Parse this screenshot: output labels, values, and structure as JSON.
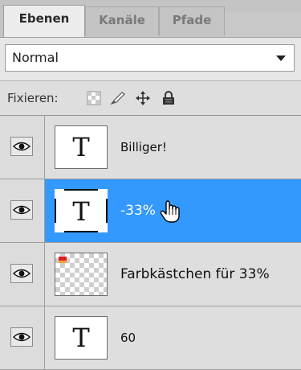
{
  "tabs": [
    {
      "label": "Ebenen",
      "active": true
    },
    {
      "label": "Kanäle",
      "active": false
    },
    {
      "label": "Pfade",
      "active": false
    }
  ],
  "blend_mode": {
    "value": "Normal"
  },
  "lock": {
    "label": "Fixieren:",
    "icons": [
      "lock-transparent-pixels-icon",
      "lock-image-pixels-icon",
      "lock-position-icon",
      "lock-all-icon"
    ]
  },
  "layers": [
    {
      "name": "Billiger!",
      "thumbnail": "T",
      "type": "text",
      "visible": true,
      "selected": false
    },
    {
      "name": "-33%",
      "thumbnail": "T",
      "type": "text",
      "visible": true,
      "selected": true
    },
    {
      "name": "Farbkästchen für 33%",
      "thumbnail": "",
      "type": "pixel",
      "visible": true,
      "selected": false
    },
    {
      "name": "60",
      "thumbnail": "T",
      "type": "text",
      "visible": true,
      "selected": false
    }
  ],
  "colors": {
    "selection": "#3399ff",
    "panel": "#dedede",
    "swatch_red": "#e02020",
    "swatch_orange": "#f3a23a"
  }
}
